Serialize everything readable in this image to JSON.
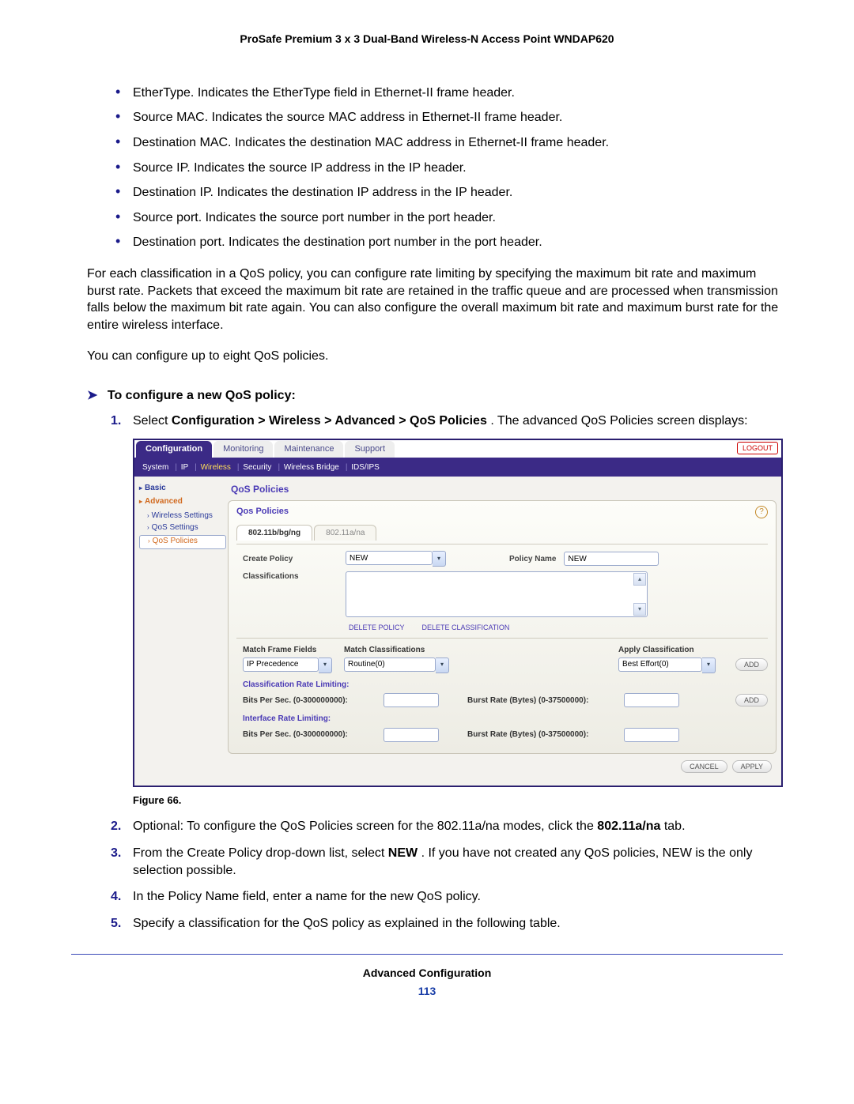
{
  "doc": {
    "title": "ProSafe Premium 3 x 3 Dual-Band Wireless-N Access Point WNDAP620",
    "footer_section": "Advanced Configuration",
    "page_number": "113",
    "figure_caption": "Figure 66."
  },
  "bullets": [
    "EtherType. Indicates the EtherType field in Ethernet-II frame header.",
    "Source MAC. Indicates the source MAC address in Ethernet-II frame header.",
    "Destination MAC. Indicates the destination MAC address in Ethernet-II frame header.",
    "Source IP. Indicates the source IP address in the IP header.",
    "Destination IP. Indicates the destination IP address in the IP header.",
    "Source port. Indicates the source port number in the port header.",
    "Destination port. Indicates the destination port number in the port header."
  ],
  "paras": {
    "p1": "For each classification in a QoS policy, you can configure rate limiting by specifying the maximum bit rate and maximum burst rate. Packets that exceed the maximum bit rate are retained in the traffic queue and are processed when transmission falls below the maximum bit rate again. You can also configure the overall maximum bit rate and maximum burst rate for the entire wireless interface.",
    "p2": "You can configure up to eight QoS policies."
  },
  "procedure": {
    "heading": "To configure a new QoS policy:",
    "step1_a": "Select ",
    "step1_b": "Configuration > Wireless > Advanced > QoS Policies",
    "step1_c": ". The advanced QoS Policies screen displays:",
    "step2_a": "Optional: To configure the QoS Policies screen for the 802.11a/na modes, click the ",
    "step2_b": "802.11a/na",
    "step2_c": " tab.",
    "step3_a": "From the Create Policy drop-down list, select ",
    "step3_b": "NEW",
    "step3_c": ". If you have not created any QoS policies, NEW is the only selection possible.",
    "step4": "In the Policy Name field, enter a name for the new QoS policy.",
    "step5": "Specify a classification for the QoS policy as explained in the following table."
  },
  "ui": {
    "tabs": [
      "Configuration",
      "Monitoring",
      "Maintenance",
      "Support"
    ],
    "logout": "LOGOUT",
    "subnav": [
      "System",
      "IP",
      "Wireless",
      "Security",
      "Wireless Bridge",
      "IDS/IPS"
    ],
    "subnav_active": "Wireless",
    "leftnav": {
      "basic": "Basic",
      "advanced": "Advanced",
      "items": [
        "Wireless Settings",
        "QoS Settings",
        "QoS Policies"
      ]
    },
    "panel_title": "QoS Policies",
    "subpanel_title": "Qos Policies",
    "mode_tabs": [
      "802.11b/bg/ng",
      "802.11a/na"
    ],
    "labels": {
      "create_policy": "Create Policy",
      "policy_name": "Policy Name",
      "classifications": "Classifications",
      "delete_policy": "DELETE POLICY",
      "delete_classification": "DELETE CLASSIFICATION",
      "match_frame_fields": "Match Frame Fields",
      "match_classifications": "Match Classifications",
      "apply_classification": "Apply Classification",
      "class_rate_limiting": "Classification Rate Limiting:",
      "iface_rate_limiting": "Interface Rate Limiting:",
      "bits_per_sec": "Bits Per Sec. (0-300000000):",
      "burst_rate": "Burst Rate (Bytes) (0-37500000):",
      "add": "ADD",
      "cancel": "CANCEL",
      "apply": "APPLY"
    },
    "values": {
      "create_policy": "NEW",
      "policy_name": "NEW",
      "match_frame_fields": "IP Precedence",
      "match_classifications": "Routine(0)",
      "apply_classification": "Best Effort(0)",
      "class_bits": "",
      "class_burst": "",
      "iface_bits": "",
      "iface_burst": ""
    }
  }
}
